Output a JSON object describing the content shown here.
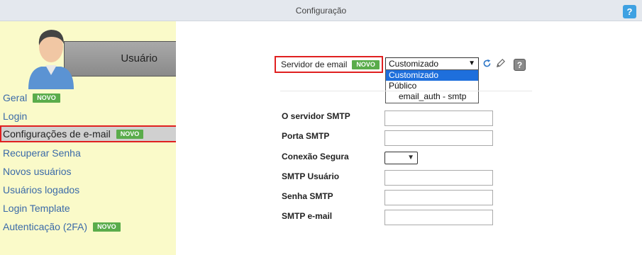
{
  "header": {
    "title": "Configuração",
    "help_label": "?"
  },
  "sidebar": {
    "user_label": "Usuário",
    "items": [
      {
        "label": "Geral",
        "badge": "NOVO"
      },
      {
        "label": "Login",
        "badge": null
      },
      {
        "label": "Configurações de e-mail",
        "badge": "NOVO",
        "active": true
      },
      {
        "label": "Recuperar Senha",
        "badge": null
      },
      {
        "label": "Novos usuários",
        "badge": null
      },
      {
        "label": "Usuários logados",
        "badge": null
      },
      {
        "label": "Login Template",
        "badge": null
      },
      {
        "label": "Autenticação (2FA)",
        "badge": "NOVO"
      }
    ]
  },
  "email_server": {
    "label": "Servidor de email",
    "badge": "NOVO",
    "selected_value": "Customizado",
    "options": [
      {
        "label": "Customizado",
        "selected": true
      },
      {
        "label": "Público",
        "group": true
      },
      {
        "label": "email_auth - smtp",
        "sub": true
      }
    ],
    "help_label": "?"
  },
  "fields": [
    {
      "label": "O servidor SMTP",
      "type": "text",
      "value": ""
    },
    {
      "label": "Porta SMTP",
      "type": "text",
      "value": ""
    },
    {
      "label": "Conexão Segura",
      "type": "select",
      "value": ""
    },
    {
      "label": "SMTP Usuário",
      "type": "text",
      "value": ""
    },
    {
      "label": "Senha SMTP",
      "type": "text",
      "value": ""
    },
    {
      "label": "SMTP e-mail",
      "type": "text",
      "value": ""
    }
  ],
  "colors": {
    "badge": "#5aac4b",
    "sidebar_bg": "#fafac9",
    "highlight_border": "#e02020",
    "link": "#3b6aa8",
    "selected_option": "#1e6fdc"
  }
}
